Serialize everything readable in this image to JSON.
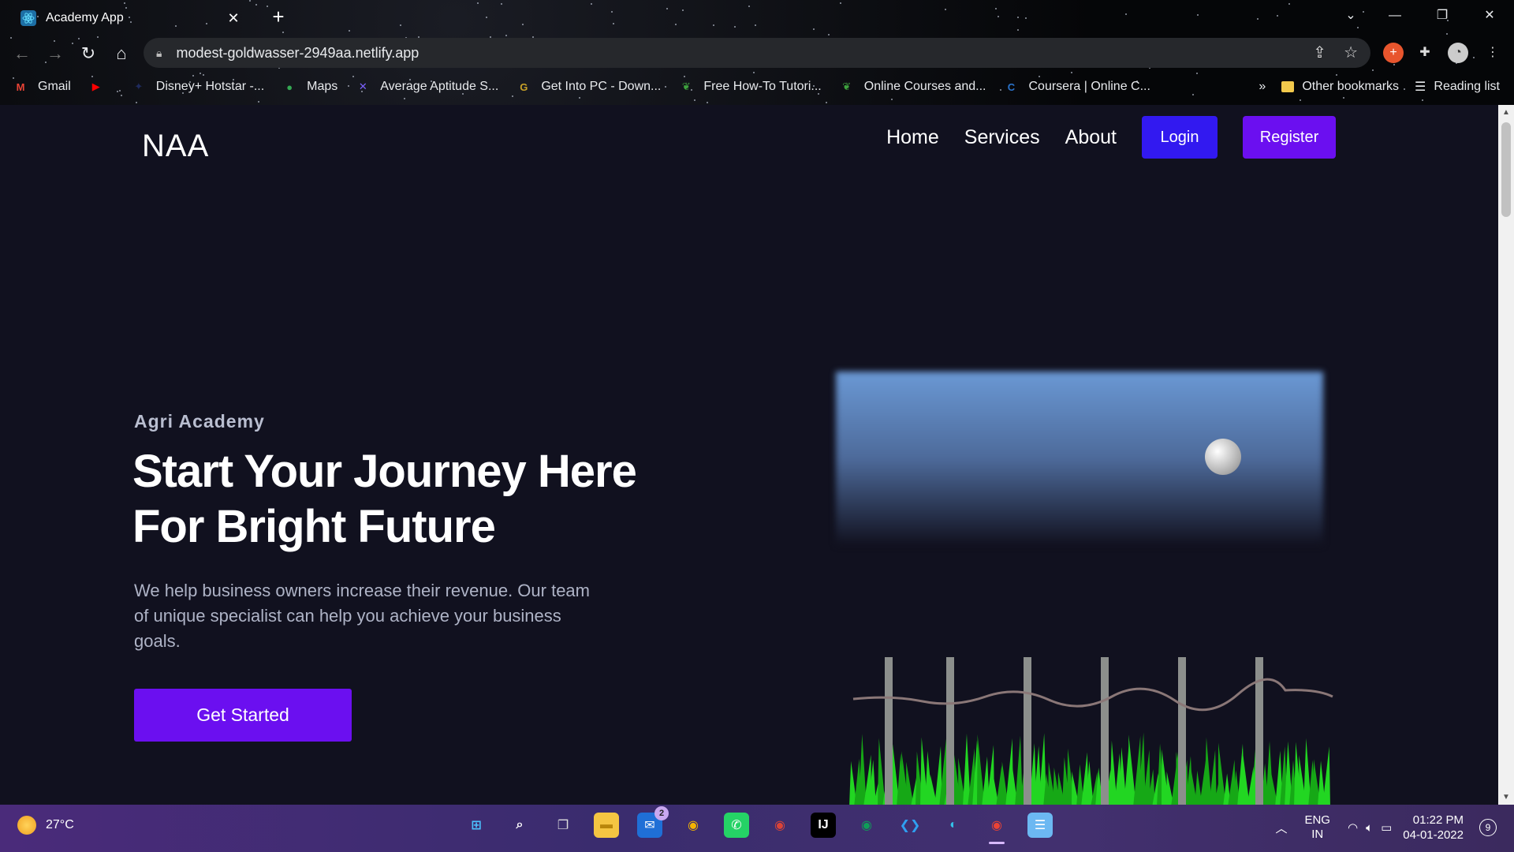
{
  "browser": {
    "tab_title": "Academy App",
    "tab_close": "✕",
    "new_tab": "+",
    "url": "modest-goldwasser-2949aa.netlify.app",
    "bookmarks": [
      {
        "label": "Gmail",
        "icon": "gmail-icon",
        "glyph": "M",
        "color": "#ea4335"
      },
      {
        "label": "",
        "icon": "youtube-icon",
        "glyph": "▶",
        "color": "#ff0000"
      },
      {
        "label": "Disney+ Hotstar -...",
        "icon": "hotstar-icon",
        "glyph": "✦",
        "color": "#1f2b5e"
      },
      {
        "label": "Maps",
        "icon": "maps-icon",
        "glyph": "●",
        "color": "#34a853"
      },
      {
        "label": "Average Aptitude S...",
        "icon": "aptitude-icon",
        "glyph": "✕",
        "color": "#7b61ff"
      },
      {
        "label": "Get Into PC - Down...",
        "icon": "getintopc-icon",
        "glyph": "G",
        "color": "#c9a227"
      },
      {
        "label": "Free How-To Tutori...",
        "icon": "leaf-icon",
        "glyph": "❦",
        "color": "#3ea33e"
      },
      {
        "label": "Online Courses and...",
        "icon": "leaf-icon",
        "glyph": "❦",
        "color": "#3ea33e"
      },
      {
        "label": "Coursera | Online C...",
        "icon": "coursera-icon",
        "glyph": "C",
        "color": "#2a73cc"
      }
    ],
    "bookmarks_overflow": "»",
    "other_bookmarks": "Other bookmarks",
    "reading_list": "Reading list"
  },
  "site": {
    "brand": "NAA",
    "nav": {
      "home": "Home",
      "services": "Services",
      "about": "About",
      "login": "Login",
      "register": "Register"
    },
    "hero": {
      "tag": "Agri Academy",
      "title_line1": "Start Your Journey Here",
      "title_line2": "For Bright Future",
      "text": "We help business owners increase their revenue. Our team of unique specialist can help you achieve your business goals.",
      "cta": "Get Started"
    }
  },
  "taskbar": {
    "weather": "27°C",
    "apps": [
      {
        "name": "windows-start-icon",
        "glyph": "⊞",
        "bg": "transparent",
        "fg": "#4cc2ff"
      },
      {
        "name": "search-icon",
        "glyph": "⌕",
        "bg": "transparent",
        "fg": "#ffffff"
      },
      {
        "name": "task-view-icon",
        "glyph": "❐",
        "bg": "transparent",
        "fg": "#dddddd"
      },
      {
        "name": "file-explorer-icon",
        "glyph": "▬",
        "bg": "#f4c542",
        "fg": "#b8860b"
      },
      {
        "name": "mail-icon",
        "glyph": "✉",
        "bg": "#1f6fd6",
        "fg": "#ffffff",
        "badge": "2"
      },
      {
        "name": "chrome-icon",
        "glyph": "◉",
        "bg": "transparent",
        "fg": "#f4b400"
      },
      {
        "name": "whatsapp-icon",
        "glyph": "✆",
        "bg": "#25d366",
        "fg": "#ffffff"
      },
      {
        "name": "chrome-profile-icon",
        "glyph": "◉",
        "bg": "transparent",
        "fg": "#db4437"
      },
      {
        "name": "intellij-icon",
        "glyph": "IJ",
        "bg": "#000000",
        "fg": "#ffffff"
      },
      {
        "name": "chrome-canary-icon",
        "glyph": "◉",
        "bg": "transparent",
        "fg": "#0f9d58"
      },
      {
        "name": "vscode-icon",
        "glyph": "❮❯",
        "bg": "transparent",
        "fg": "#2f9ff0"
      },
      {
        "name": "edge-icon",
        "glyph": "◐",
        "bg": "transparent",
        "fg": "#34c1e8"
      },
      {
        "name": "chrome-active-icon",
        "glyph": "◉",
        "bg": "transparent",
        "fg": "#ea4335",
        "active": true
      },
      {
        "name": "notepad-icon",
        "glyph": "☰",
        "bg": "#6cb8f2",
        "fg": "#ffffff"
      }
    ],
    "lang_line1": "ENG",
    "lang_line2": "IN",
    "time": "01:22 PM",
    "date": "04-01-2022",
    "notifications": "9"
  }
}
